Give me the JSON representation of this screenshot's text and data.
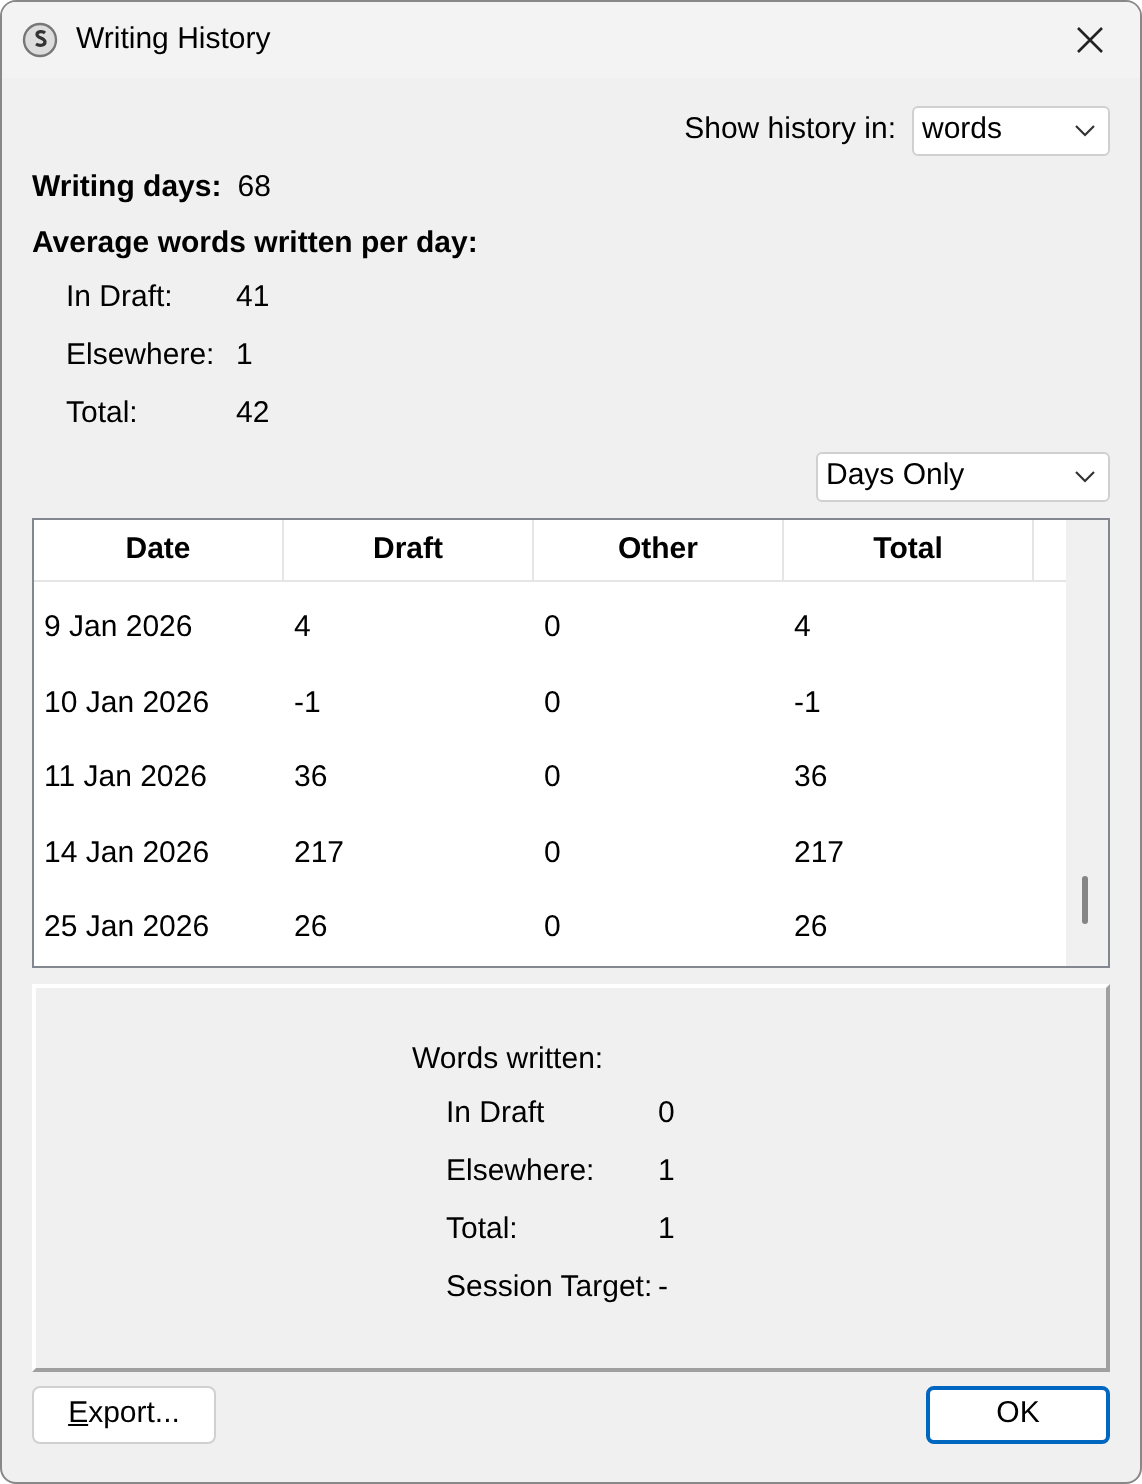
{
  "window": {
    "title": "Writing History"
  },
  "show_history": {
    "label": "Show history in:",
    "value": "words"
  },
  "writing_days": {
    "label": "Writing days:",
    "value": "68"
  },
  "average": {
    "heading": "Average words written per day:",
    "rows": [
      {
        "label": "In Draft:",
        "value": "41"
      },
      {
        "label": "Elsewhere:",
        "value": "1"
      },
      {
        "label": "Total:",
        "value": "42"
      }
    ]
  },
  "range_select": {
    "value": "Days Only"
  },
  "table": {
    "columns": [
      "Date",
      "Draft",
      "Other",
      "Total"
    ],
    "rows": [
      [
        "9 Jan 2026",
        "4",
        "0",
        "4"
      ],
      [
        "10 Jan 2026",
        "-1",
        "0",
        "-1"
      ],
      [
        "11 Jan 2026",
        "36",
        "0",
        "36"
      ],
      [
        "14 Jan 2026",
        "217",
        "0",
        "217"
      ],
      [
        "25 Jan 2026",
        "26",
        "0",
        "26"
      ]
    ]
  },
  "session": {
    "heading": "Words written:",
    "rows": [
      {
        "label": "In Draft",
        "value": "0"
      },
      {
        "label": "Elsewhere:",
        "value": "1"
      },
      {
        "label": "Total:",
        "value": "1"
      },
      {
        "label": "Session Target:",
        "value": "-"
      }
    ]
  },
  "buttons": {
    "export": "Export...",
    "ok": "OK"
  }
}
